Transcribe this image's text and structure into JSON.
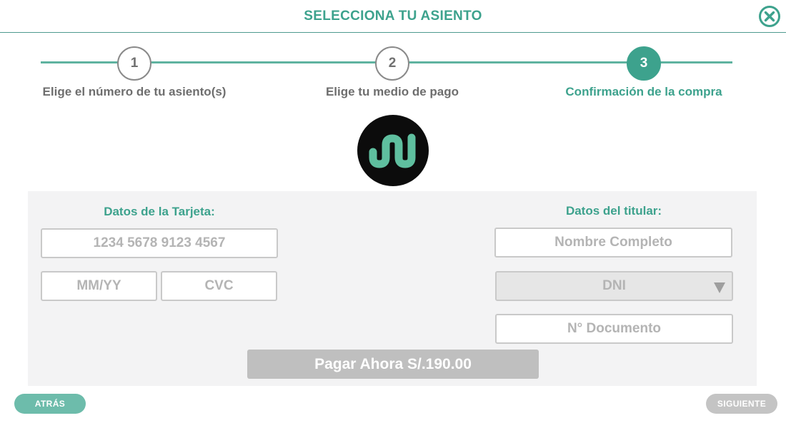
{
  "header": {
    "title": "SELECCIONA TU ASIENTO",
    "close_icon": "close-circle-icon"
  },
  "stepper": {
    "steps": [
      {
        "number": "1",
        "label": "Elige el número de tu asiento(s)",
        "active": false
      },
      {
        "number": "2",
        "label": "Elige tu medio de pago",
        "active": false
      },
      {
        "number": "3",
        "label": "Confirmación de la compra",
        "active": true
      }
    ]
  },
  "logo": {
    "icon": "brand-logo"
  },
  "card_section": {
    "title": "Datos de la Tarjeta:",
    "card_number_placeholder": "1234 5678 9123 4567",
    "expiry_placeholder": "MM/YY",
    "cvc_placeholder": "CVC"
  },
  "holder_section": {
    "title": "Datos del titular:",
    "name_placeholder": "Nombre Completo",
    "doc_type_value": "DNI",
    "doc_number_placeholder": "N° Documento"
  },
  "pay_button": {
    "label": "Pagar Ahora S/.190.00"
  },
  "nav": {
    "back_label": "ATRÁS",
    "next_label": "SIGUIENTE"
  },
  "colors": {
    "accent": "#3da28d",
    "muted": "#c4c4c4"
  }
}
